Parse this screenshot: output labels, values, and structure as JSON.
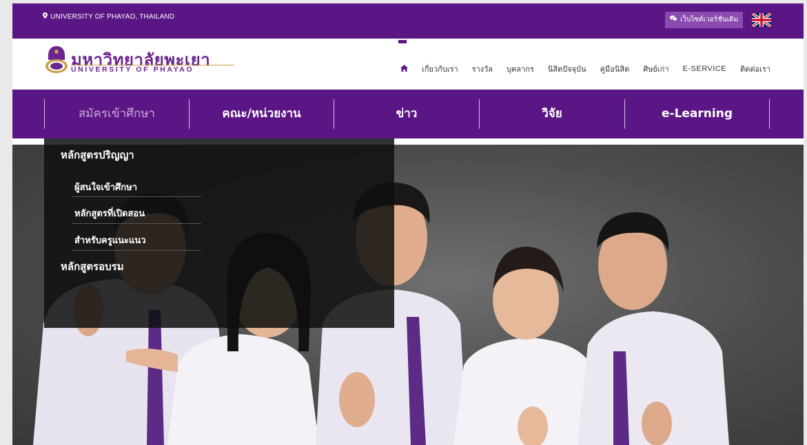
{
  "topbar": {
    "location": "UNIVERSITY OF PHAYAO, THAILAND",
    "legacy_site_label": "เว็บไซต์เวอร์ชั่นเดิม",
    "language_flag": "united-kingdom-flag"
  },
  "logo": {
    "thai_name": "มหาวิทยาลัยพะเยา",
    "english_name": "UNIVERSITY OF PHAYAO"
  },
  "nav": {
    "items": [
      "เกี่ยวกับเรา",
      "รางวัล",
      "บุคลากร",
      "นิสิตปัจจุบัน",
      "คู่มือนิสิต",
      "ศิษย์เก่า",
      "E-SERVICE",
      "ติดต่อเรา"
    ]
  },
  "main_menu": {
    "items": [
      "สมัครเข้าศึกษา",
      "คณะ/หน่วยงาน",
      "ข่าว",
      "วิจัย",
      "e-Learning"
    ]
  },
  "dropdown": {
    "degree_programs": "หลักสูตรปริญญา",
    "sub_items": [
      "ผู้สนใจเข้าศึกษา",
      "หลักสูตรที่เปิดสอน",
      "สำหรับครูแนะแนว"
    ],
    "training_programs": "หลักสูตรอบรม"
  },
  "colors": {
    "brand_purple": "#5b1685",
    "button_purple": "#8a4bb1",
    "accent_gold": "#c9a24a"
  }
}
